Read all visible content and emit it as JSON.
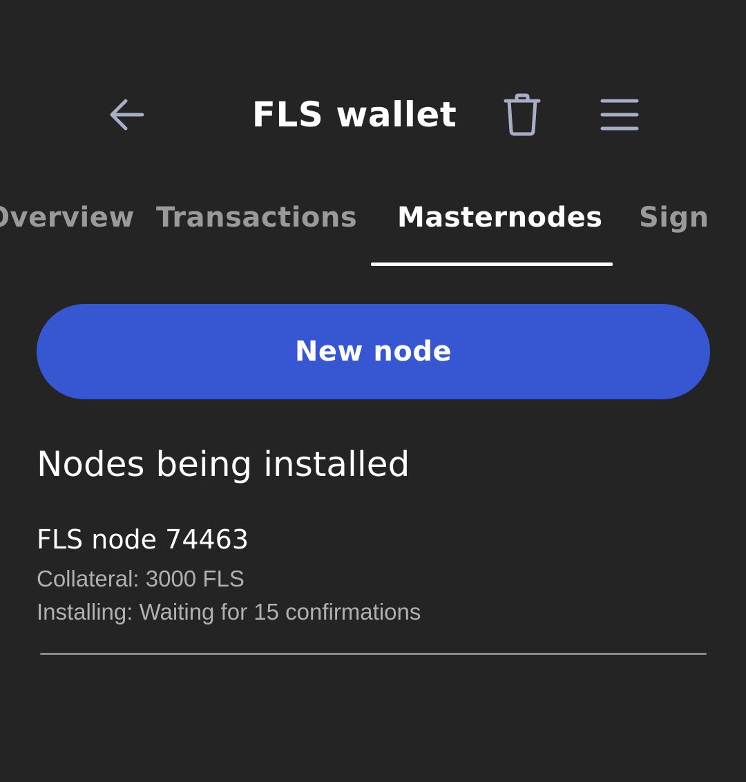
{
  "header": {
    "title": "FLS wallet",
    "back_icon": "arrow-left-icon",
    "delete_icon": "trash-icon",
    "menu_icon": "hamburger-menu-icon"
  },
  "tabs": [
    {
      "label": "Overview",
      "active": false
    },
    {
      "label": "Transactions",
      "active": false
    },
    {
      "label": "Masternodes",
      "active": true
    },
    {
      "label": "Sign",
      "active": false
    }
  ],
  "new_node_button": {
    "label": "New node"
  },
  "section": {
    "heading": "Nodes being installed",
    "nodes": [
      {
        "name": "FLS node 74463",
        "collateral": "Collateral: 3000 FLS",
        "status": "Installing: Waiting for 15 confirmations"
      }
    ]
  },
  "colors": {
    "background": "#242424",
    "accent": "#3657d1",
    "icon": "#a7aec6",
    "muted_text": "#b0b0b0"
  }
}
